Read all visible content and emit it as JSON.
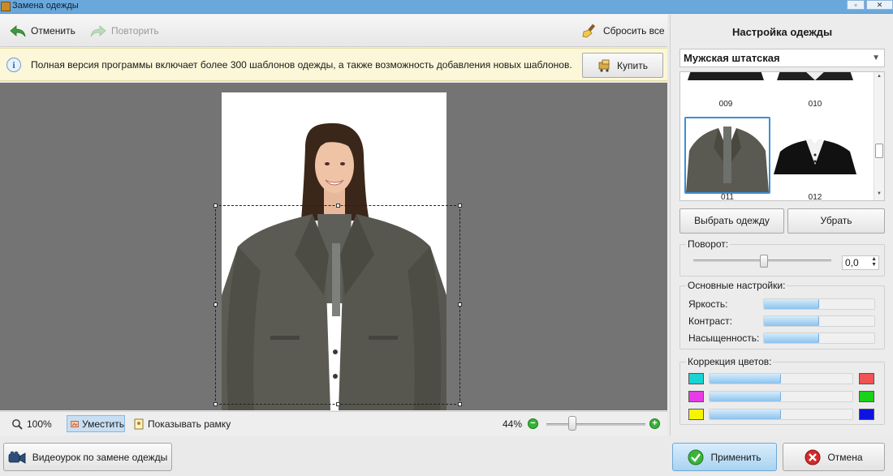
{
  "window": {
    "title": "Замена одежды"
  },
  "toolbar": {
    "undo_label": "Отменить",
    "redo_label": "Повторить",
    "reset_label": "Сбросить все"
  },
  "infobar": {
    "message": "Полная версия программы включает более 300 шаблонов одежды, а также возможность добавления новых шаблонов.",
    "buy_label": "Купить"
  },
  "statusbar": {
    "zoom_100_label": "100%",
    "fit_label": "Уместить",
    "show_frame_label": "Показывать рамку",
    "zoom_percent": "44%"
  },
  "footer": {
    "video_lesson_label": "Видеоурок по замене одежды",
    "apply_label": "Применить",
    "cancel_label": "Отмена"
  },
  "panel": {
    "title": "Настройка одежды",
    "category": "Мужская штатская",
    "thumbnails": [
      {
        "label": "009",
        "selected": false
      },
      {
        "label": "010",
        "selected": false
      },
      {
        "label": "011",
        "selected": true
      },
      {
        "label": "012",
        "selected": false
      }
    ],
    "choose_label": "Выбрать одежду",
    "remove_label": "Убрать",
    "rotation": {
      "title": "Поворот:",
      "value": "0,0"
    },
    "basic": {
      "title": "Основные настройки:",
      "sliders": [
        {
          "label": "Яркость:",
          "level": 0.5
        },
        {
          "label": "Контраст:",
          "level": 0.5
        },
        {
          "label": "Насыщенность:",
          "level": 0.5
        }
      ]
    },
    "color": {
      "title": "Коррекция цветов:",
      "rows": [
        {
          "left": "#19d3d3",
          "right": "#f25353",
          "level": 0.5
        },
        {
          "left": "#e63be6",
          "right": "#19d219",
          "level": 0.5
        },
        {
          "left": "#f5f500",
          "right": "#0d14e0",
          "level": 0.5
        }
      ]
    }
  },
  "colors": {
    "titlebar": "#6aa8dc",
    "canvas_bg": "#747474",
    "accent": "#6ea8d6"
  }
}
